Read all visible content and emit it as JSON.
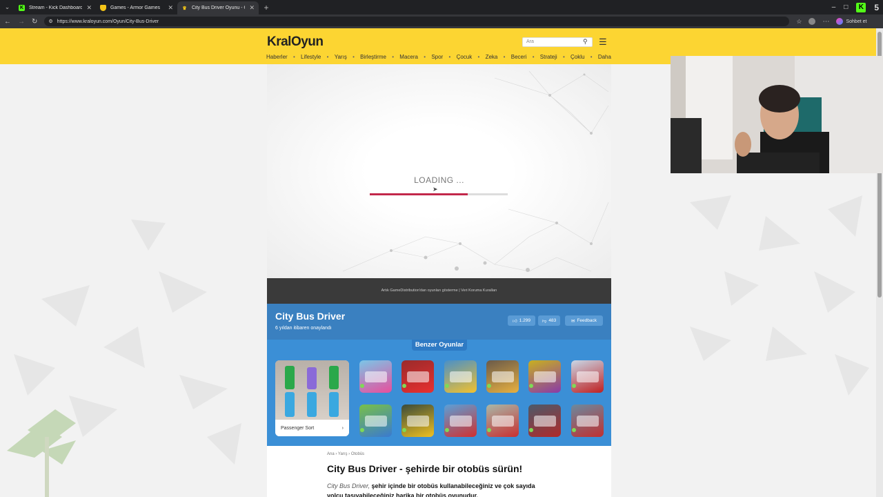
{
  "browser": {
    "tabs": [
      {
        "title": "Stream - Kick Dashboard",
        "favicon": "kick-icon",
        "color": "#53fc18",
        "active": false
      },
      {
        "title": "Games - Armor Games",
        "favicon": "shield-icon",
        "color": "#f5c518",
        "active": false
      },
      {
        "title": "City Bus Driver Oyunu - Online ü...",
        "favicon": "crown-icon",
        "color": "#f5c518",
        "active": true
      }
    ],
    "url": "https://www.kraloyun.com/Oyun/City-Bus-Driver",
    "chat_label": "Sohbet et",
    "kick_count": "5"
  },
  "site": {
    "logo": "KralOyun",
    "search_placeholder": "Ara",
    "nav": [
      "Haberler",
      "Lifestyle",
      "Yarış",
      "Birleştirme",
      "Macera",
      "Spor",
      "Çocuk",
      "Zeka",
      "Beceri",
      "Strateji",
      "Çoklu",
      "Daha"
    ]
  },
  "game": {
    "loading_text": "LOADING ...",
    "loading_progress": 0.71,
    "notice": "Artık GameDistribution'dan oyunları gösterme | Veri Koruma Kuralları",
    "title": "City Bus Driver",
    "subtitle": "6 yıldan itibaren onaylandı",
    "likes": "1.299",
    "dislikes": "483",
    "feedback": "Feedback"
  },
  "similar": {
    "heading": "Benzer Oyunlar",
    "featured": "Passenger Sort",
    "thumbs": [
      {
        "color": "#7ac6e8",
        "accent": "#e94e9c"
      },
      {
        "color": "#9a2b2b",
        "accent": "#e83030"
      },
      {
        "color": "#4a90c8",
        "accent": "#f2c12e"
      },
      {
        "color": "#6a5a4a",
        "accent": "#e8b040"
      },
      {
        "color": "#c8b020",
        "accent": "#8a3aa8"
      },
      {
        "color": "#c8d8e8",
        "accent": "#c02020"
      },
      {
        "color": "#78c048",
        "accent": "#3a7ad0"
      },
      {
        "color": "#3a4a3a",
        "accent": "#f0c020"
      },
      {
        "color": "#5aa0d8",
        "accent": "#d03030"
      },
      {
        "color": "#a8b8a8",
        "accent": "#c83030"
      },
      {
        "color": "#4a5a6a",
        "accent": "#b02a2a"
      },
      {
        "color": "#6a8aa0",
        "accent": "#c03030"
      }
    ]
  },
  "article": {
    "breadcrumb": [
      "Ana",
      "Yarış",
      "Otobüs"
    ],
    "title": "City Bus Driver - şehirde bir otobüs sürün!",
    "lead_italic": "City Bus Driver,",
    "lead_text": "şehir içinde bir otobüs kullanabileceğiniz ve çok sayıda yolcu taşıyabileceğiniz harika bir otobüs oyunudur."
  }
}
